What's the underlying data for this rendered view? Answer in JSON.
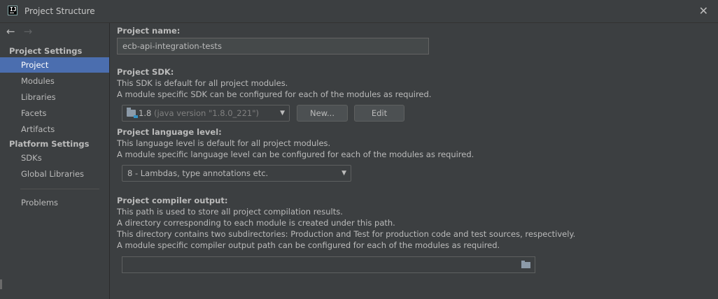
{
  "window": {
    "title": "Project Structure"
  },
  "sidebar": {
    "project_settings_header": "Project Settings",
    "platform_settings_header": "Platform Settings",
    "items": [
      {
        "label": "Project"
      },
      {
        "label": "Modules"
      },
      {
        "label": "Libraries"
      },
      {
        "label": "Facets"
      },
      {
        "label": "Artifacts"
      },
      {
        "label": "SDKs"
      },
      {
        "label": "Global Libraries"
      },
      {
        "label": "Problems"
      }
    ],
    "selected": "Project"
  },
  "project_name": {
    "label": "Project name:",
    "value": "ecb-api-integration-tests"
  },
  "project_sdk": {
    "label": "Project SDK:",
    "desc1": "This SDK is default for all project modules.",
    "desc2": "A module specific SDK can be configured for each of the modules as required.",
    "selected_version": "1.8",
    "selected_detail": "(java version \"1.8.0_221\")",
    "new_button": "New...",
    "edit_button": "Edit"
  },
  "language_level": {
    "label": "Project language level:",
    "desc1": "This language level is default for all project modules.",
    "desc2": "A module specific language level can be configured for each of the modules as required.",
    "selected": "8 - Lambdas, type annotations etc."
  },
  "compiler_output": {
    "label": "Project compiler output:",
    "desc1": "This path is used to store all project compilation results.",
    "desc2": "A directory corresponding to each module is created under this path.",
    "desc3": "This directory contains two subdirectories: Production and Test for production code and test sources, respectively.",
    "desc4": "A module specific compiler output path can be configured for each of the modules as required.",
    "value": ""
  },
  "colors": {
    "background": "#3c3f41",
    "selection": "#4b6eaf",
    "text": "#bbbbbb"
  }
}
